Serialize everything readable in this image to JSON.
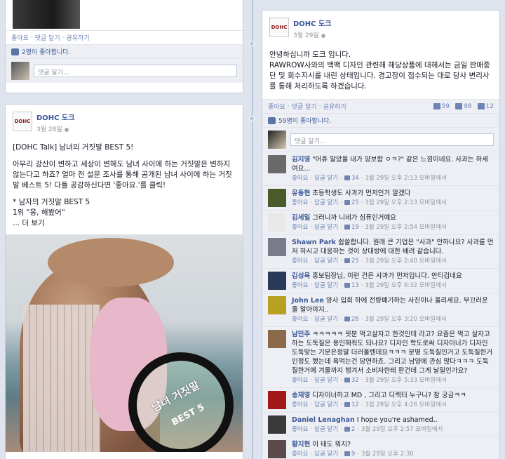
{
  "left_top": {
    "actions": [
      "좋아요",
      "댓글 달기",
      "공유하기"
    ],
    "likes": "2명이 좋아합니다.",
    "comment_placeholder": "댓글 달기..."
  },
  "left_post": {
    "page_name": "DOHC 도크",
    "logo_text": "DOHC",
    "date": "3월 28일",
    "paragraphs": [
      "[DOHC Talk] 남녀의 거짓말 BEST 5!",
      "아무리 강산이 변하고 세상이 변해도 남녀 사이에 하는 거짓말은 변하지 않는다고 하죠? 얼마 전 설문 조사를 통해 공개된 남녀 사이에 하는 거짓말 베스트 5! 다들 공감하신다면 '좋아요.'를 클릭!",
      "* 남자의 거짓말 BEST 5",
      "1위 \"응, 해봤어\"",
      "... 더 보기"
    ],
    "photo_text_1": "남녀 거짓말",
    "photo_text_2": "BEST 5"
  },
  "right_post": {
    "page_name": "DOHC 도크",
    "logo_text": "DOHC",
    "date": "3월 29일",
    "greeting": "안녕하십니까 도크 입니다.",
    "body": "RAWROW사와의 백팩 디자인 관련해 해당상품에 대해서는 금일 판매중단 및 회수지시를 내린 상태입니다. 경고장이 접수되는 대로 당사 변리사를 통해 처리하도록 하겠습니다.",
    "actions": [
      "좋아요",
      "댓글 달기",
      "공유하기"
    ],
    "counts": {
      "likes": "59",
      "comments": "98",
      "shares": "12"
    },
    "likes_text": "59명이 좋아합니다.",
    "comment_placeholder": "댓글 달기...",
    "comments": [
      {
        "name": "김지영",
        "text": "\"어휴 알았을 내가 양보함 ㅇㅋ?\" 같은 느낌이네요. 사과는 하세여요...",
        "likes": "34",
        "time": "3월 29일 오후 2:13 모바일에서",
        "avatar": "#6a6a6a"
      },
      {
        "name": "유동현",
        "text": "초등학생도 사과가 먼저인거 알겠다",
        "likes": "25",
        "time": "3월 29일 오후 2:13 모바일에서",
        "avatar": "#4a5a2a"
      },
      {
        "name": "김세일",
        "text": "그러니까 니네가 심퓨인거예요",
        "likes": "19",
        "time": "3월 29일 오후 2:54 모바일에서",
        "avatar": "#e8e8e8"
      },
      {
        "name": "Shawn Park",
        "text": "쉽쓸합니다. 원래 큰 기업은 \"사과\" 안하나요? 사과를 먼저 하시고 대응하는 것이 상대방에 대한 배려 같습니다.",
        "likes": "25",
        "time": "3월 29일 오후 2:40 모바일에서",
        "avatar": "#7a7a8a"
      },
      {
        "name": "김성욱",
        "text": "홍보팀장님, 이런 건은 사과가 먼저입니다. 안티겁네요",
        "likes": "13",
        "time": "3월 29일 오후 6:32 모바일에서",
        "avatar": "#2a3a5a"
      },
      {
        "name": "John Lee",
        "text": "양사 입회 하에 전량폐기하는 사진이나 올리세요. 부끄러운 줄 알아야지..",
        "likes": "26",
        "time": "3월 29일 오후 3:20 모바일에서",
        "avatar": "#b8a020"
      },
      {
        "name": "남민주",
        "text": "ㅋㅋㅋㅋㅋ 읫분 먹고살자고 한것인데 라고? 요즘은 먹고 살자고하는 도둑질은 용인해줘도 되나요? 디자인 학도로써 디자이너가 디자인 도둑맞는 기분은정말 더러울텐데요ㅋㅋㅋ 분명 도둑질인거고 도둑질한거 인정도 했는데 욕먹는건 당연하죠. 그리고 남양에 관심 많다ㅋㅋㅋ 도둑질한거에 겨울까지 챙겨서 소비자한테 판건데 그게 날일인가요?",
        "likes": "32",
        "time": "3월 29일 오후 5:33 모바일에서",
        "avatar": "#8a6a4a"
      },
      {
        "name": "송재영",
        "text": "디자이너하고 MD , 그리고 디렉터 누구니? 참 궁금ㅋㅋ",
        "likes": "12",
        "time": "3월 29일 오후 4:26 모바일에서",
        "avatar": "#a01818"
      },
      {
        "name": "Daniel Lenaghan",
        "text": "I hope you're ashamed..",
        "likes": "2",
        "time": "3월 29일 오후 2:57 모바일에서",
        "avatar": "#3a3a3a"
      },
      {
        "name": "황지현",
        "text": "이 태도 뭐지?",
        "likes": "9",
        "time": "3월 29일 오후 2:30",
        "avatar": "#5a4a4a"
      }
    ]
  }
}
